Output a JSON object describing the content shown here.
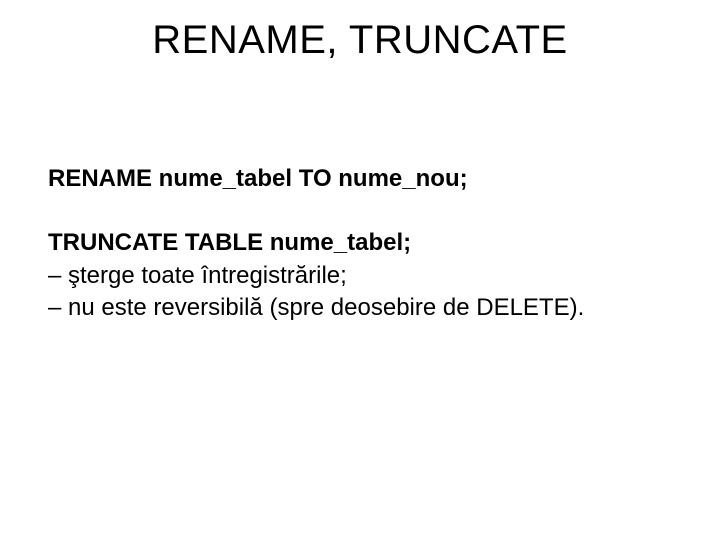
{
  "title": "RENAME, TRUNCATE",
  "rename_stmt": "RENAME nume_tabel TO nume_nou;",
  "truncate_stmt": "TRUNCATE TABLE nume_tabel;",
  "note1": "– şterge toate întregistrările;",
  "note2": "– nu este reversibilă (spre deosebire de DELETE)."
}
